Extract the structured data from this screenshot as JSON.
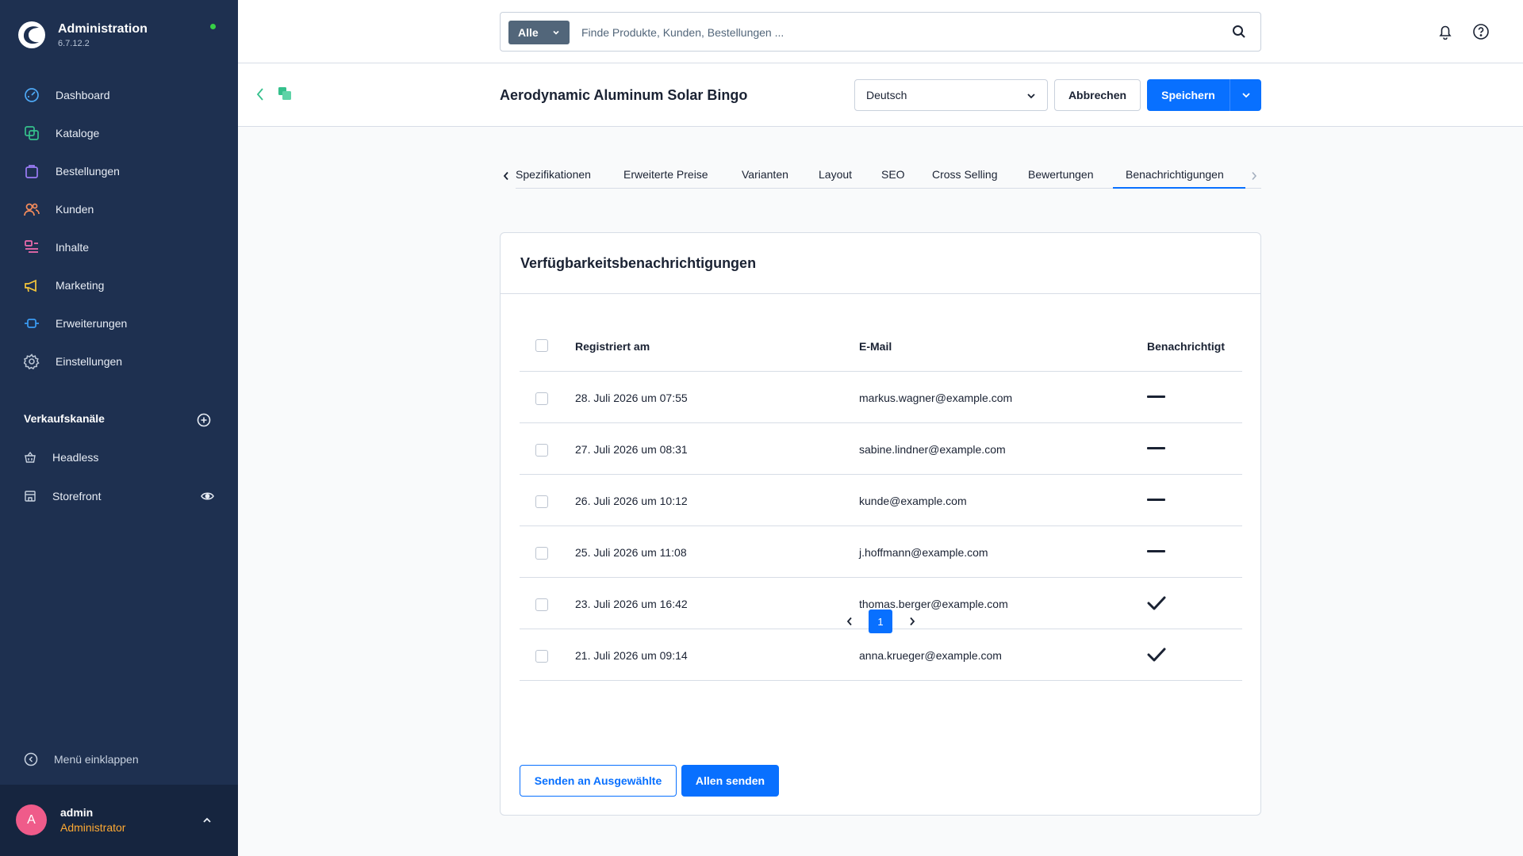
{
  "brand": {
    "title": "Administration",
    "version": "6.7.12.2"
  },
  "nav": [
    {
      "label": "Dashboard",
      "icon": "dashboard-icon",
      "color": "#4ea8f5"
    },
    {
      "label": "Kataloge",
      "icon": "catalog-icon",
      "color": "#35c08c"
    },
    {
      "label": "Bestellungen",
      "icon": "bag-icon",
      "color": "#9b7cf6"
    },
    {
      "label": "Kunden",
      "icon": "users-icon",
      "color": "#f58c5c"
    },
    {
      "label": "Inhalte",
      "icon": "content-icon",
      "color": "#f06bae"
    },
    {
      "label": "Marketing",
      "icon": "megaphone-icon",
      "color": "#f5c63b"
    },
    {
      "label": "Erweiterungen",
      "icon": "plug-icon",
      "color": "#3b9cf5"
    },
    {
      "label": "Einstellungen",
      "icon": "gear-icon",
      "color": "#b9c4d3"
    }
  ],
  "sales_channels": {
    "title": "Verkaufskanäle",
    "items": [
      {
        "label": "Headless",
        "icon": "basket-icon"
      },
      {
        "label": "Storefront",
        "icon": "storefront-icon"
      }
    ]
  },
  "collapse_label": "Menü einklappen",
  "user": {
    "initial": "A",
    "name": "admin",
    "role": "Administrator"
  },
  "search": {
    "type_label": "Alle",
    "placeholder": "Finde Produkte, Kunden, Bestellungen ..."
  },
  "smartbar": {
    "title": "Aerodynamic Aluminum Solar Bingo",
    "language": "Deutsch",
    "cancel_label": "Abbrechen",
    "save_label": "Speichern"
  },
  "tabs": [
    {
      "label": "Spezifikationen",
      "active": false
    },
    {
      "label": "Erweiterte Preise",
      "active": false
    },
    {
      "label": "Varianten",
      "active": false
    },
    {
      "label": "Layout",
      "active": false
    },
    {
      "label": "SEO",
      "active": false
    },
    {
      "label": "Cross Selling",
      "active": false
    },
    {
      "label": "Bewertungen",
      "active": false
    },
    {
      "label": "Benachrichtigungen",
      "active": true
    }
  ],
  "card": {
    "title": "Verfügbarkeitsbenachrichtigungen",
    "columns": {
      "registered": "Registriert am",
      "email": "E-Mail",
      "notified": "Benachrichtigt"
    },
    "rows": [
      {
        "registered": "28. Juli 2026 um 07:55",
        "email": "markus.wagner@example.com",
        "notified": false
      },
      {
        "registered": "27. Juli 2026 um 08:31",
        "email": "sabine.lindner@example.com",
        "notified": false
      },
      {
        "registered": "26. Juli 2026 um 10:12",
        "email": "kunde@example.com",
        "notified": false
      },
      {
        "registered": "25. Juli 2026 um 11:08",
        "email": "j.hoffmann@example.com",
        "notified": false
      },
      {
        "registered": "23. Juli 2026 um 16:42",
        "email": "thomas.berger@example.com",
        "notified": true
      },
      {
        "registered": "21. Juli 2026 um 09:14",
        "email": "anna.krueger@example.com",
        "notified": true
      }
    ],
    "pagination": {
      "current_page": "1"
    },
    "send_selected_label": "Senden an Ausgewählte",
    "send_all_label": "Allen senden"
  },
  "colors": {
    "sidebar": "#1e3050",
    "accent": "#0870ff",
    "status_online": "#37d046",
    "role": "#ffaa33"
  }
}
